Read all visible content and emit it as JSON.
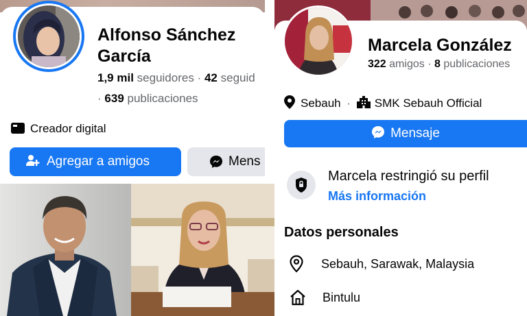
{
  "left_profile": {
    "name": "Alfonso Sánchez García",
    "followers_count": "1,9 mil",
    "followers_label": "seguidores",
    "following_count": "42",
    "following_label": "seguid",
    "posts_count": "639",
    "posts_label": "publicaciones",
    "category": "Creador digital",
    "add_friend_label": "Agregar a amigos",
    "message_label": "Mens"
  },
  "right_profile": {
    "name": "Marcela González",
    "friends_count": "322",
    "friends_label": "amigos",
    "posts_count": "8",
    "posts_label": "publicaciones",
    "location_short": "Sebauh",
    "workplace": "SMK Sebauh Official",
    "message_label": "Mensaje",
    "restricted_text": "Marcela restringió su perfil",
    "more_info_label": "Más información",
    "personal_heading": "Datos personales",
    "location_full": "Sebauh, Sarawak, Malaysia",
    "hometown": "Bintulu"
  },
  "colors": {
    "accent": "#1877f2",
    "secondary_button": "#e4e6eb",
    "muted_text": "#65676b"
  },
  "icons": {
    "creator": "creator-icon",
    "add_friend": "add-friend-icon",
    "messenger": "messenger-icon",
    "location": "location-pin-icon",
    "workplace": "building-icon",
    "lock": "lock-icon",
    "home": "home-icon"
  }
}
